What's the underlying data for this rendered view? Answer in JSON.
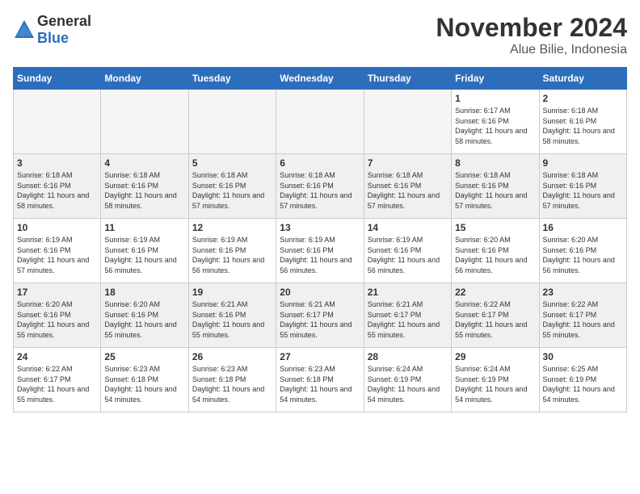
{
  "logo": {
    "general": "General",
    "blue": "Blue"
  },
  "title": "November 2024",
  "subtitle": "Alue Bilie, Indonesia",
  "days_of_week": [
    "Sunday",
    "Monday",
    "Tuesday",
    "Wednesday",
    "Thursday",
    "Friday",
    "Saturday"
  ],
  "weeks": [
    [
      {
        "day": "",
        "empty": true
      },
      {
        "day": "",
        "empty": true
      },
      {
        "day": "",
        "empty": true
      },
      {
        "day": "",
        "empty": true
      },
      {
        "day": "",
        "empty": true
      },
      {
        "day": "1",
        "sunrise": "Sunrise: 6:17 AM",
        "sunset": "Sunset: 6:16 PM",
        "daylight": "Daylight: 11 hours and 58 minutes."
      },
      {
        "day": "2",
        "sunrise": "Sunrise: 6:18 AM",
        "sunset": "Sunset: 6:16 PM",
        "daylight": "Daylight: 11 hours and 58 minutes."
      }
    ],
    [
      {
        "day": "3",
        "sunrise": "Sunrise: 6:18 AM",
        "sunset": "Sunset: 6:16 PM",
        "daylight": "Daylight: 11 hours and 58 minutes."
      },
      {
        "day": "4",
        "sunrise": "Sunrise: 6:18 AM",
        "sunset": "Sunset: 6:16 PM",
        "daylight": "Daylight: 11 hours and 58 minutes."
      },
      {
        "day": "5",
        "sunrise": "Sunrise: 6:18 AM",
        "sunset": "Sunset: 6:16 PM",
        "daylight": "Daylight: 11 hours and 57 minutes."
      },
      {
        "day": "6",
        "sunrise": "Sunrise: 6:18 AM",
        "sunset": "Sunset: 6:16 PM",
        "daylight": "Daylight: 11 hours and 57 minutes."
      },
      {
        "day": "7",
        "sunrise": "Sunrise: 6:18 AM",
        "sunset": "Sunset: 6:16 PM",
        "daylight": "Daylight: 11 hours and 57 minutes."
      },
      {
        "day": "8",
        "sunrise": "Sunrise: 6:18 AM",
        "sunset": "Sunset: 6:16 PM",
        "daylight": "Daylight: 11 hours and 57 minutes."
      },
      {
        "day": "9",
        "sunrise": "Sunrise: 6:18 AM",
        "sunset": "Sunset: 6:16 PM",
        "daylight": "Daylight: 11 hours and 57 minutes."
      }
    ],
    [
      {
        "day": "10",
        "sunrise": "Sunrise: 6:19 AM",
        "sunset": "Sunset: 6:16 PM",
        "daylight": "Daylight: 11 hours and 57 minutes."
      },
      {
        "day": "11",
        "sunrise": "Sunrise: 6:19 AM",
        "sunset": "Sunset: 6:16 PM",
        "daylight": "Daylight: 11 hours and 56 minutes."
      },
      {
        "day": "12",
        "sunrise": "Sunrise: 6:19 AM",
        "sunset": "Sunset: 6:16 PM",
        "daylight": "Daylight: 11 hours and 56 minutes."
      },
      {
        "day": "13",
        "sunrise": "Sunrise: 6:19 AM",
        "sunset": "Sunset: 6:16 PM",
        "daylight": "Daylight: 11 hours and 56 minutes."
      },
      {
        "day": "14",
        "sunrise": "Sunrise: 6:19 AM",
        "sunset": "Sunset: 6:16 PM",
        "daylight": "Daylight: 11 hours and 56 minutes."
      },
      {
        "day": "15",
        "sunrise": "Sunrise: 6:20 AM",
        "sunset": "Sunset: 6:16 PM",
        "daylight": "Daylight: 11 hours and 56 minutes."
      },
      {
        "day": "16",
        "sunrise": "Sunrise: 6:20 AM",
        "sunset": "Sunset: 6:16 PM",
        "daylight": "Daylight: 11 hours and 56 minutes."
      }
    ],
    [
      {
        "day": "17",
        "sunrise": "Sunrise: 6:20 AM",
        "sunset": "Sunset: 6:16 PM",
        "daylight": "Daylight: 11 hours and 55 minutes."
      },
      {
        "day": "18",
        "sunrise": "Sunrise: 6:20 AM",
        "sunset": "Sunset: 6:16 PM",
        "daylight": "Daylight: 11 hours and 55 minutes."
      },
      {
        "day": "19",
        "sunrise": "Sunrise: 6:21 AM",
        "sunset": "Sunset: 6:16 PM",
        "daylight": "Daylight: 11 hours and 55 minutes."
      },
      {
        "day": "20",
        "sunrise": "Sunrise: 6:21 AM",
        "sunset": "Sunset: 6:17 PM",
        "daylight": "Daylight: 11 hours and 55 minutes."
      },
      {
        "day": "21",
        "sunrise": "Sunrise: 6:21 AM",
        "sunset": "Sunset: 6:17 PM",
        "daylight": "Daylight: 11 hours and 55 minutes."
      },
      {
        "day": "22",
        "sunrise": "Sunrise: 6:22 AM",
        "sunset": "Sunset: 6:17 PM",
        "daylight": "Daylight: 11 hours and 55 minutes."
      },
      {
        "day": "23",
        "sunrise": "Sunrise: 6:22 AM",
        "sunset": "Sunset: 6:17 PM",
        "daylight": "Daylight: 11 hours and 55 minutes."
      }
    ],
    [
      {
        "day": "24",
        "sunrise": "Sunrise: 6:22 AM",
        "sunset": "Sunset: 6:17 PM",
        "daylight": "Daylight: 11 hours and 55 minutes."
      },
      {
        "day": "25",
        "sunrise": "Sunrise: 6:23 AM",
        "sunset": "Sunset: 6:18 PM",
        "daylight": "Daylight: 11 hours and 54 minutes."
      },
      {
        "day": "26",
        "sunrise": "Sunrise: 6:23 AM",
        "sunset": "Sunset: 6:18 PM",
        "daylight": "Daylight: 11 hours and 54 minutes."
      },
      {
        "day": "27",
        "sunrise": "Sunrise: 6:23 AM",
        "sunset": "Sunset: 6:18 PM",
        "daylight": "Daylight: 11 hours and 54 minutes."
      },
      {
        "day": "28",
        "sunrise": "Sunrise: 6:24 AM",
        "sunset": "Sunset: 6:19 PM",
        "daylight": "Daylight: 11 hours and 54 minutes."
      },
      {
        "day": "29",
        "sunrise": "Sunrise: 6:24 AM",
        "sunset": "Sunset: 6:19 PM",
        "daylight": "Daylight: 11 hours and 54 minutes."
      },
      {
        "day": "30",
        "sunrise": "Sunrise: 6:25 AM",
        "sunset": "Sunset: 6:19 PM",
        "daylight": "Daylight: 11 hours and 54 minutes."
      }
    ]
  ]
}
